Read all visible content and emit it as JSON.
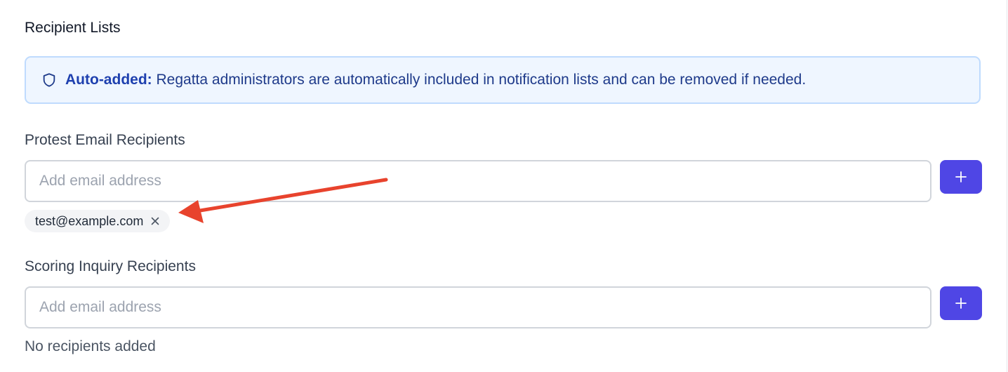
{
  "recipient_lists": {
    "title": "Recipient Lists",
    "notice": {
      "icon": "shield-icon",
      "bold": "Auto-added:",
      "text": "Regatta administrators are automatically included in notification lists and can be removed if needed."
    },
    "protest": {
      "label": "Protest Email Recipients",
      "input_placeholder": "Add email address",
      "input_value": "",
      "add_icon": "plus-icon",
      "recipients": [
        "test@example.com"
      ]
    },
    "scoring": {
      "label": "Scoring Inquiry Recipients",
      "input_placeholder": "Add email address",
      "input_value": "",
      "add_icon": "plus-icon",
      "empty_text": "No recipients added"
    }
  },
  "colors": {
    "accent": "#4f46e5",
    "notice_bg": "#eff6ff",
    "notice_border": "#bfdbfe",
    "notice_text": "#1e3a8a",
    "annotation_arrow": "#e8432d"
  }
}
